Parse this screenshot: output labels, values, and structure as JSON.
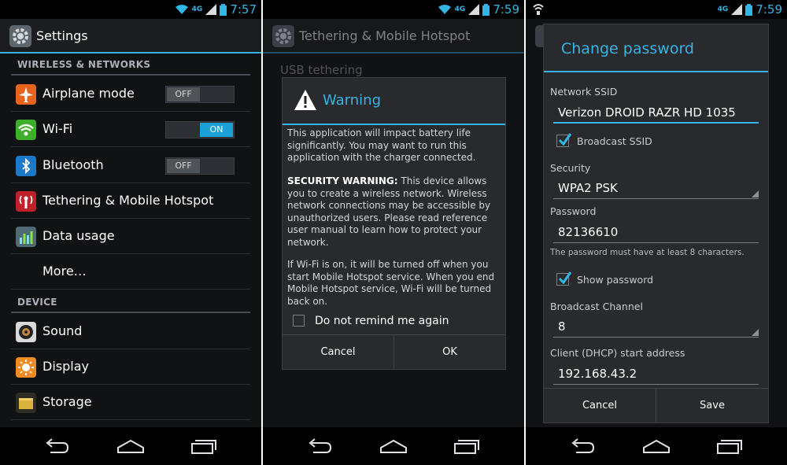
{
  "panel1": {
    "status": {
      "network": "4G",
      "time": "7:57"
    },
    "title": "Settings",
    "sections": [
      {
        "header": "WIRELESS & NETWORKS"
      },
      {
        "header": "DEVICE"
      }
    ],
    "items": [
      {
        "label": "Airplane mode",
        "icon": "airplane-icon",
        "toggle": "OFF"
      },
      {
        "label": "Wi-Fi",
        "icon": "wifi-icon",
        "toggle": "ON"
      },
      {
        "label": "Bluetooth",
        "icon": "bluetooth-icon",
        "toggle": "OFF"
      },
      {
        "label": "Tethering & Mobile Hotspot",
        "icon": "hotspot-icon"
      },
      {
        "label": "Data usage",
        "icon": "data-usage-icon"
      },
      {
        "label": "More…"
      },
      {
        "label": "Sound",
        "icon": "speaker-icon"
      },
      {
        "label": "Display",
        "icon": "brightness-icon"
      },
      {
        "label": "Storage",
        "icon": "storage-icon"
      }
    ],
    "colors": {
      "accent": "#33b5e5",
      "background": "#101214"
    }
  },
  "panel2": {
    "status": {
      "network": "4G",
      "time": "7:59"
    },
    "title": "Tethering & Mobile Hotspot",
    "background_item": "USB tethering",
    "dialog": {
      "title": "Warning",
      "para1": "This application will impact battery life significantly. You may want to run this application with the charger connected.",
      "para2_bold": "SECURITY WARNING:",
      "para2": " This device allows you to create a wireless network. Wireless network connections may be accessible by unauthorized users. Please read reference user manual to learn how to protect your network.",
      "para3": " If Wi-Fi is on, it will be turned off when you start Mobile Hotspot service. When you end Mobile Hotspot service, Wi-Fi will be turned back on.",
      "checkbox_label": "Do not remind me again",
      "cancel": "Cancel",
      "ok": "OK"
    }
  },
  "panel3": {
    "status": {
      "network": "4G",
      "time": "7:59"
    },
    "dialog": {
      "title": "Change password",
      "ssid_label": "Network SSID",
      "ssid_value": "Verizon DROID RAZR HD 1035",
      "broadcast_ssid": "Broadcast SSID",
      "security_label": "Security",
      "security_value": "WPA2 PSK",
      "password_label": "Password",
      "password_value": "82136610",
      "password_hint": "The password must have at least 8 characters.",
      "show_password": "Show password",
      "channel_label": "Broadcast Channel",
      "channel_value": "8",
      "dhcp_label": "Client (DHCP) start address",
      "dhcp_value": "192.168.43.2",
      "cancel": "Cancel",
      "save": "Save"
    }
  }
}
